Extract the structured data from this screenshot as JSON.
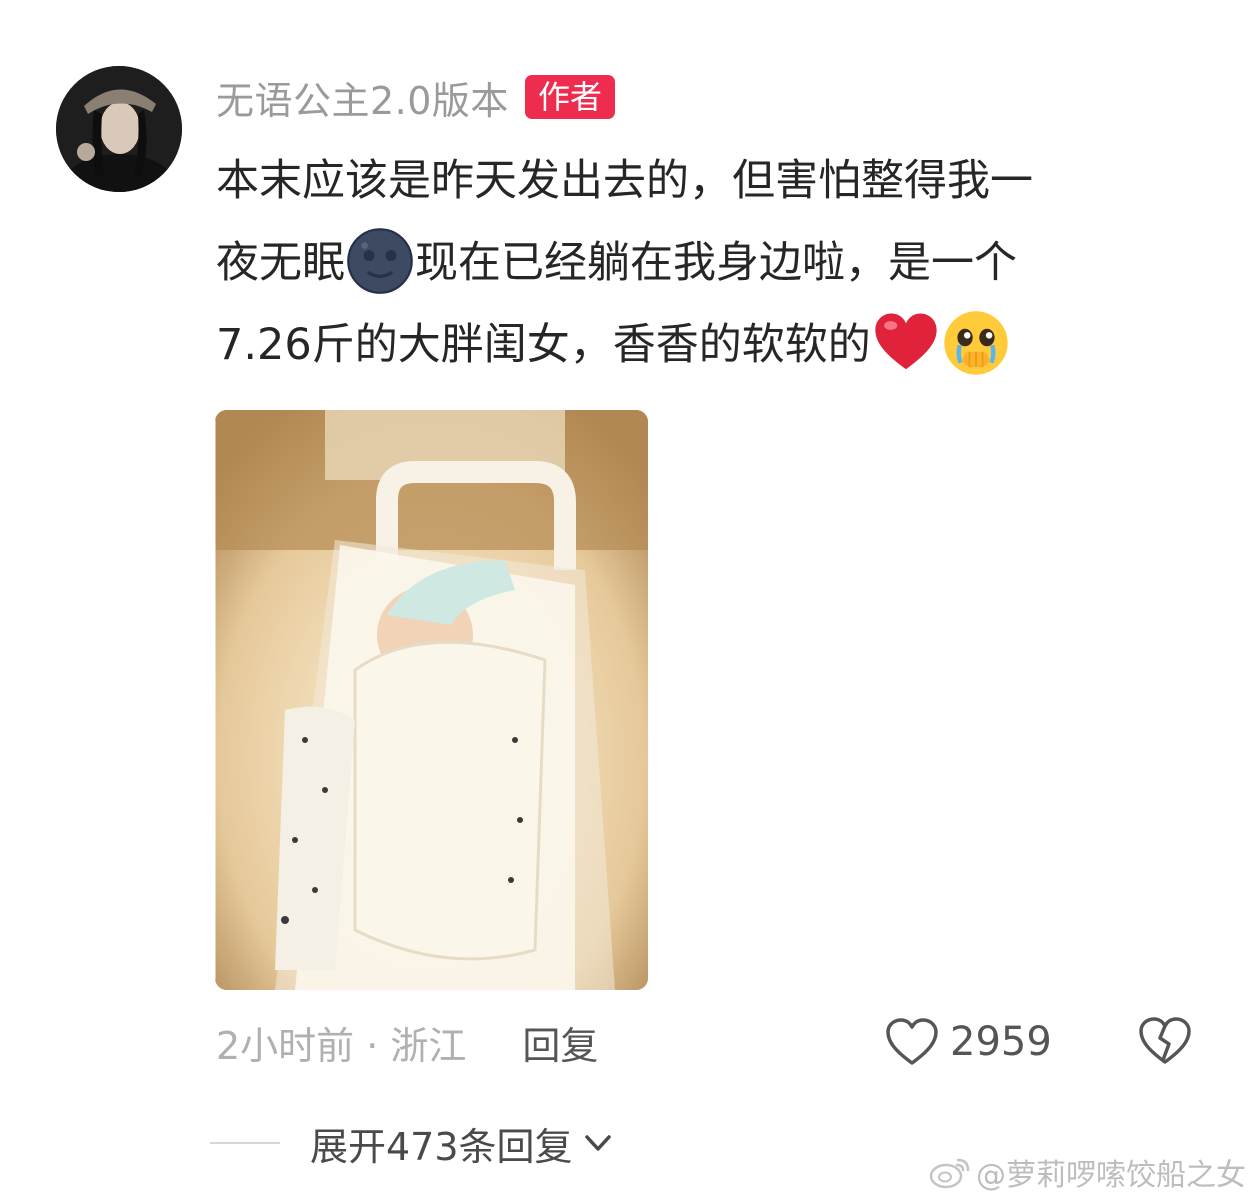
{
  "author": {
    "name": "无语公主2.0版本",
    "badge": "作者"
  },
  "comment": {
    "line1": "本末应该是昨天发出去的，但害怕整得我一",
    "line2_a": "夜无眠",
    "line2_b": "现在已经躺在我身边啦，是一个",
    "line3": "7.26斤的大胖闺女，香香的软软的",
    "emojis": [
      "new-moon-face-icon",
      "red-heart-icon",
      "crying-pleading-face-icon"
    ]
  },
  "meta": {
    "time_location": "2小时前 · 浙江",
    "reply": "回复",
    "likes": "2959"
  },
  "expand": {
    "label": "展开473条回复"
  },
  "watermark": {
    "text": "@萝莉啰嗦饺船之女"
  }
}
